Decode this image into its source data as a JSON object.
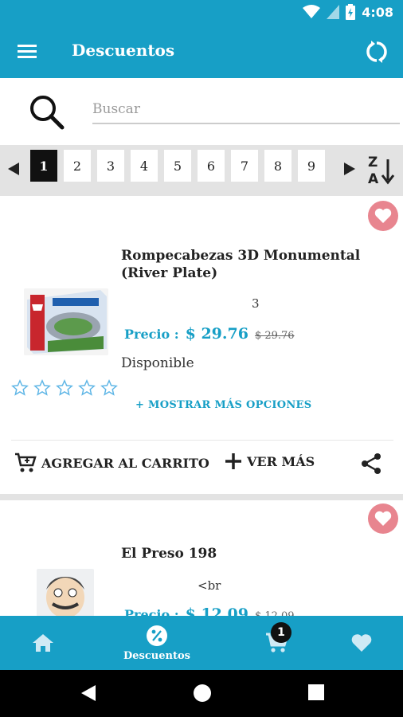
{
  "status_bar": {
    "time": "4:08"
  },
  "app_bar": {
    "title": "Descuentos"
  },
  "search": {
    "placeholder": "Buscar",
    "value": ""
  },
  "pager": {
    "pages": [
      "1",
      "2",
      "3",
      "4",
      "5",
      "6",
      "7",
      "8",
      "9"
    ],
    "active_page": "1"
  },
  "products": [
    {
      "title": "Rompecabezas 3D Monumental (River Plate)",
      "quantity": "3",
      "price_label": "Precio :",
      "price": "$ 29.76",
      "old_price": "$ 29.76",
      "availability": "Disponible",
      "rating": 0,
      "rating_max": 5,
      "more_options": "+ MOSTRAR MÁS OPCIONES",
      "add_to_cart": "AGREGAR AL CARRITO",
      "view_more": "VER MÁS"
    },
    {
      "title": "El Preso 198",
      "quantity": "<br",
      "price_label": "Precio :",
      "price": "$ 12.09",
      "old_price": "$ 12.09"
    }
  ],
  "bottom_nav": {
    "items": [
      {
        "icon": "home-icon",
        "label": ""
      },
      {
        "icon": "discount-icon",
        "label": "Descuentos"
      },
      {
        "icon": "cart-icon",
        "label": ""
      },
      {
        "icon": "heart-icon",
        "label": ""
      }
    ],
    "cart_count": "1"
  },
  "colors": {
    "primary": "#179fc6",
    "favorite": "#e8858f",
    "pager_bg": "#e3e3e3"
  }
}
